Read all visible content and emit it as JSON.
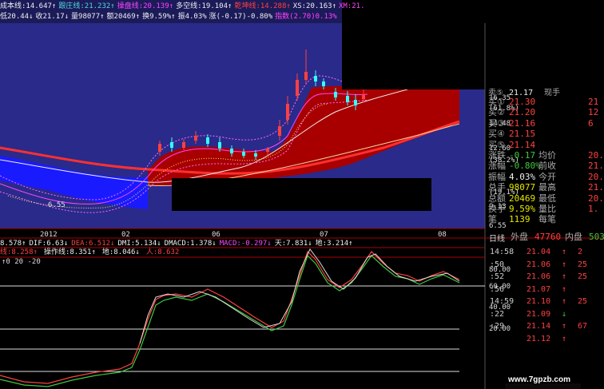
{
  "colors": {
    "up": "#ff4040",
    "down": "#3ec83e",
    "accent": "#e6e600",
    "bg": "#000000",
    "panel_blue": "#2a2a8a",
    "fill_red": "#a80000",
    "fill_blue": "#1a1aff"
  },
  "legend": {
    "items": [
      {
        "text": "成本线:14.647↑",
        "color": "#eeeeee"
      },
      {
        "text": "跟庄线:21.232↑",
        "color": "#4fd9d9"
      },
      {
        "text": "操盘线:20.139↑",
        "color": "#ff44ff"
      },
      {
        "text": "多空线:19.104↑",
        "color": "#eeeeee"
      },
      {
        "text": "乾坤线:14.288↑",
        "color": "#ff4040"
      },
      {
        "text": "XS:20.163↑",
        "color": "#eeeeee"
      },
      {
        "text": "XM:21.",
        "color": "#ff44ff"
      }
    ],
    "ohlc": [
      {
        "text": "低20.44↓",
        "color": "#eeeeee"
      },
      {
        "text": "收21.17↓",
        "color": "#eeeeee"
      },
      {
        "text": "量98077↑",
        "color": "#eeeeee"
      },
      {
        "text": "额20469↑",
        "color": "#eeeeee"
      },
      {
        "text": "换9.59%↑",
        "color": "#eeeeee"
      },
      {
        "text": "振4.03%",
        "color": "#eeeeee"
      },
      {
        "text": "涨(-0.17)-0.80%",
        "color": "#eeeeee"
      },
      {
        "text": "指数(2.70)0.13%",
        "color": "#ff44ff"
      }
    ]
  },
  "price_axis": [
    "16.35",
    "(61.8%)",
    "14.48",
    "12.60",
    "(38.2%)",
    "(19.1%)",
    "9.13",
    "6.55"
  ],
  "low_marker": "6.55",
  "x_axis": {
    "labels": [
      "2012",
      "02",
      "06",
      "07",
      "08"
    ],
    "period": "日线"
  },
  "indicator_row1": {
    "items": [
      {
        "text": "8.578↑",
        "color": "#eeeeee"
      },
      {
        "text": "DIF:6.63↓",
        "color": "#eeeeee"
      },
      {
        "text": "DEA:6.512↓",
        "color": "#ff4040"
      },
      {
        "text": "DMI:5.134↓",
        "color": "#eeeeee"
      },
      {
        "text": "DMACD:1.378↓",
        "color": "#eeeeee"
      },
      {
        "text": "MACD:-0.297↓",
        "color": "#ff44ff"
      },
      {
        "text": "天:7.831↓",
        "color": "#eeeeee"
      },
      {
        "text": "地:3.214↑",
        "color": "#eeeeee"
      }
    ]
  },
  "indicator_row2": {
    "items": [
      {
        "text": "线:8.258↑",
        "color": "#ff4040"
      },
      {
        "text": "操作线:8.351↑",
        "color": "#eeeeee"
      },
      {
        "text": "地:8.046↓",
        "color": "#eeeeee"
      },
      {
        "text": "人:8.632",
        "color": "#ff4040"
      }
    ]
  },
  "osc_header": "↑0 20 -20",
  "osc_axis": [
    "80.00",
    "60.00",
    "40.00",
    "20.00"
  ],
  "quote": {
    "head": {
      "label": "卖⑤",
      "value": "21.17",
      "extra": "现手"
    },
    "rows": [
      {
        "lbl": "卖①",
        "v1": "",
        "l2": "",
        "v2": "",
        "c1": "#eeeeee"
      },
      {
        "lbl": "买①",
        "v1": "21.30",
        "l2": "",
        "v2": "21",
        "c1": "#ff4040"
      },
      {
        "lbl": "买②",
        "v1": "21.20",
        "l2": "",
        "v2": "12",
        "c1": "#ff4040"
      },
      {
        "lbl": "买③",
        "v1": "21.16",
        "l2": "",
        "v2": "6",
        "c1": "#ff4040"
      },
      {
        "lbl": "买④",
        "v1": "21.15",
        "l2": "",
        "v2": "",
        "c1": "#ff4040"
      },
      {
        "lbl": "买⑤",
        "v1": "21.14",
        "l2": "",
        "v2": "",
        "c1": "#ff4040"
      },
      {
        "lbl": "涨跌",
        "v1": "-0.17",
        "l2": "均价",
        "v2": "20.",
        "c1": "#3ec83e"
      },
      {
        "lbl": "涨幅",
        "v1": "-0.80%",
        "l2": "前收",
        "v2": "21.",
        "c1": "#3ec83e"
      },
      {
        "lbl": "振幅",
        "v1": "4.03%",
        "l2": "今开",
        "v2": "20.",
        "c1": "#eeeeee"
      },
      {
        "lbl": "总手",
        "v1": "98077",
        "l2": "最高",
        "v2": "21.",
        "c1": "#e6e600"
      },
      {
        "lbl": "总额",
        "v1": "20469",
        "l2": "最低",
        "v2": "20.",
        "c1": "#e6e600"
      },
      {
        "lbl": "换手",
        "v1": "9.59%",
        "l2": "量比",
        "v2": "1.",
        "c1": "#e6e600"
      },
      {
        "lbl": "笔",
        "v1": "1139",
        "l2": "每笔",
        "v2": "",
        "c1": "#e6e600"
      }
    ],
    "outer": {
      "lbl": "外盘",
      "v1": "47760",
      "l2": "内盘",
      "v2": "503"
    }
  },
  "ticks": [
    {
      "t": "14:58",
      "p": "21.04",
      "a": "↑",
      "v": "2"
    },
    {
      "t": ":50",
      "p": "21.06",
      "a": "↑",
      "v": "25"
    },
    {
      "t": ":52",
      "p": "21.06",
      "a": "↑",
      "v": "25"
    },
    {
      "t": ":56",
      "p": "21.07",
      "a": "↑",
      "v": ""
    },
    {
      "t": "14:59",
      "p": "21.10",
      "a": "↑",
      "v": "25"
    },
    {
      "t": ":22",
      "p": "21.09",
      "a": "↓",
      "v": ""
    },
    {
      "t": ":29",
      "p": "21.14",
      "a": "↑",
      "v": "67"
    },
    {
      "t": "",
      "p": "21.12",
      "a": "↑",
      "v": ""
    }
  ],
  "watermark": "www.7gpzb.com"
}
